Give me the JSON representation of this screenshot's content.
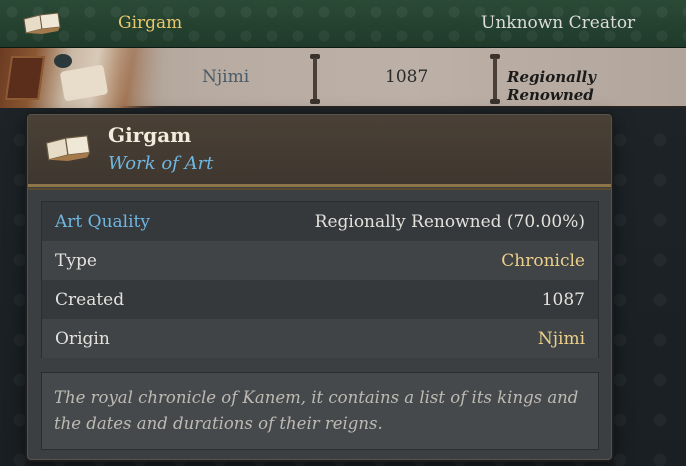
{
  "list_row_top": {
    "title": "Girgam",
    "creator": "Unknown Creator",
    "icon": "book-icon"
  },
  "list_row_selected": {
    "origin": "Njimi",
    "year": "1087",
    "renown": "Regionally Renowned"
  },
  "tooltip": {
    "icon": "book-icon",
    "title": "Girgam",
    "subtitle": "Work of Art",
    "rows": [
      {
        "label": "Art Quality",
        "value": "Regionally Renowned (70.00%)"
      },
      {
        "label": "Type",
        "value": "Chronicle"
      },
      {
        "label": "Created",
        "value": "1087"
      },
      {
        "label": "Origin",
        "value": "Njimi"
      }
    ],
    "description": "The royal chronicle of Kanem, it contains a list of its kings and the dates and durations of their reigns."
  },
  "colors": {
    "accent_gold": "#e9c76c",
    "accent_blue": "#6fb6e0",
    "header_green": "#2b4a36"
  }
}
